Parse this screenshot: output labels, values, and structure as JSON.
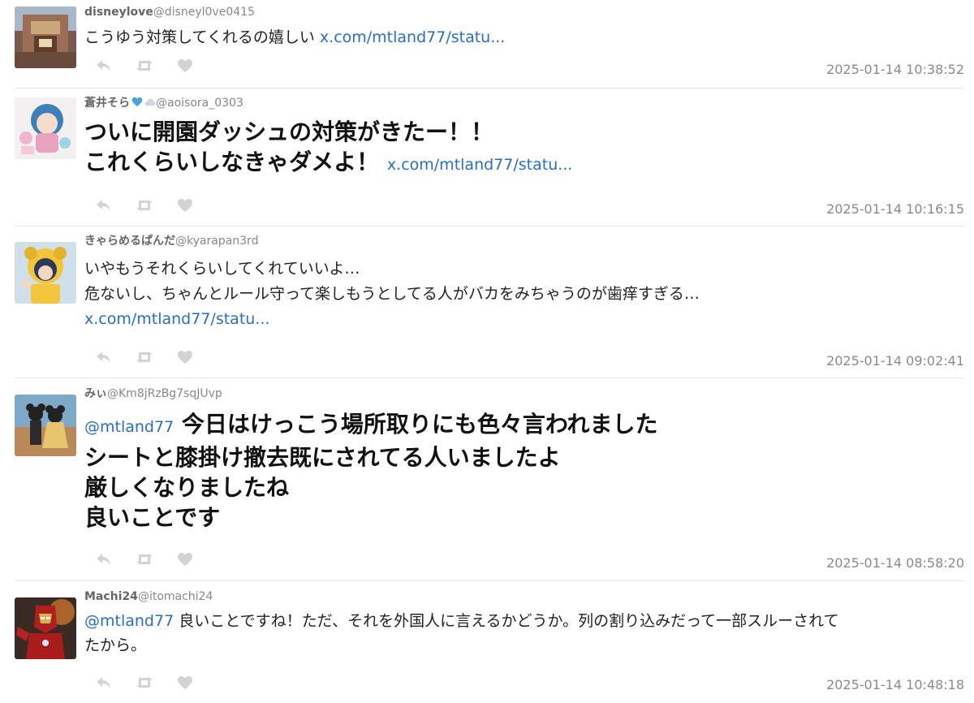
{
  "tweets": [
    {
      "display_name": "disneylove",
      "handle": "@disneyl0ve0415",
      "lines": [
        {
          "text": "こうゆう対策してくれるの嬉しい ",
          "link": "x.com/mtland77/statu..."
        }
      ],
      "timestamp": "2025-01-14 10:38:52"
    },
    {
      "display_name": "蒼井そら",
      "handle": "@aoisora_0303",
      "lines": [
        {
          "text": "ついに開園ダッシュの対策がきたー！！"
        },
        {
          "text": "これくらいしなきゃダメよ！ ",
          "link": "x.com/mtland77/statu..."
        }
      ],
      "timestamp": "2025-01-14 10:16:15"
    },
    {
      "display_name": "きゃらめるぱんだ",
      "handle": "@kyarapan3rd",
      "lines": [
        {
          "text": "いやもうそれくらいしてくれていいよ…"
        },
        {
          "text": "危ないし、ちゃんとルール守って楽しもうとしてる人がバカをみちゃうのが歯痒すぎる…"
        },
        {
          "link": "x.com/mtland77/statu..."
        }
      ],
      "timestamp": "2025-01-14 09:02:41"
    },
    {
      "display_name": "みぃ",
      "handle": "@Km8jRzBg7sqJUvp",
      "lines": [
        {
          "mention": "@mtland77",
          "text": " 今日はけっこう場所取りにも色々言われました"
        },
        {
          "text": "シートと膝掛け撤去既にされてる人いましたよ"
        },
        {
          "text": "厳しくなりましたね"
        },
        {
          "text": "良いことです"
        }
      ],
      "timestamp": "2025-01-14 08:58:20"
    },
    {
      "display_name": "Machi24",
      "handle": "@itomachi24",
      "lines": [
        {
          "mention": "@mtland77",
          "text": " 良いことですね！ただ、それを外国人に言えるかどうか。列の割り込みだって一部スルーされて"
        },
        {
          "text": "たから。"
        }
      ],
      "timestamp": "2025-01-14 10:48:18"
    }
  ],
  "icons": {
    "reply": "reply-icon",
    "retweet": "retweet-icon",
    "like": "heart-icon"
  },
  "colors": {
    "link": "#2a6ebd",
    "icon": "#d3d3d3",
    "timestamp": "#8a8a8a",
    "name_heart": "#4aa3df"
  }
}
